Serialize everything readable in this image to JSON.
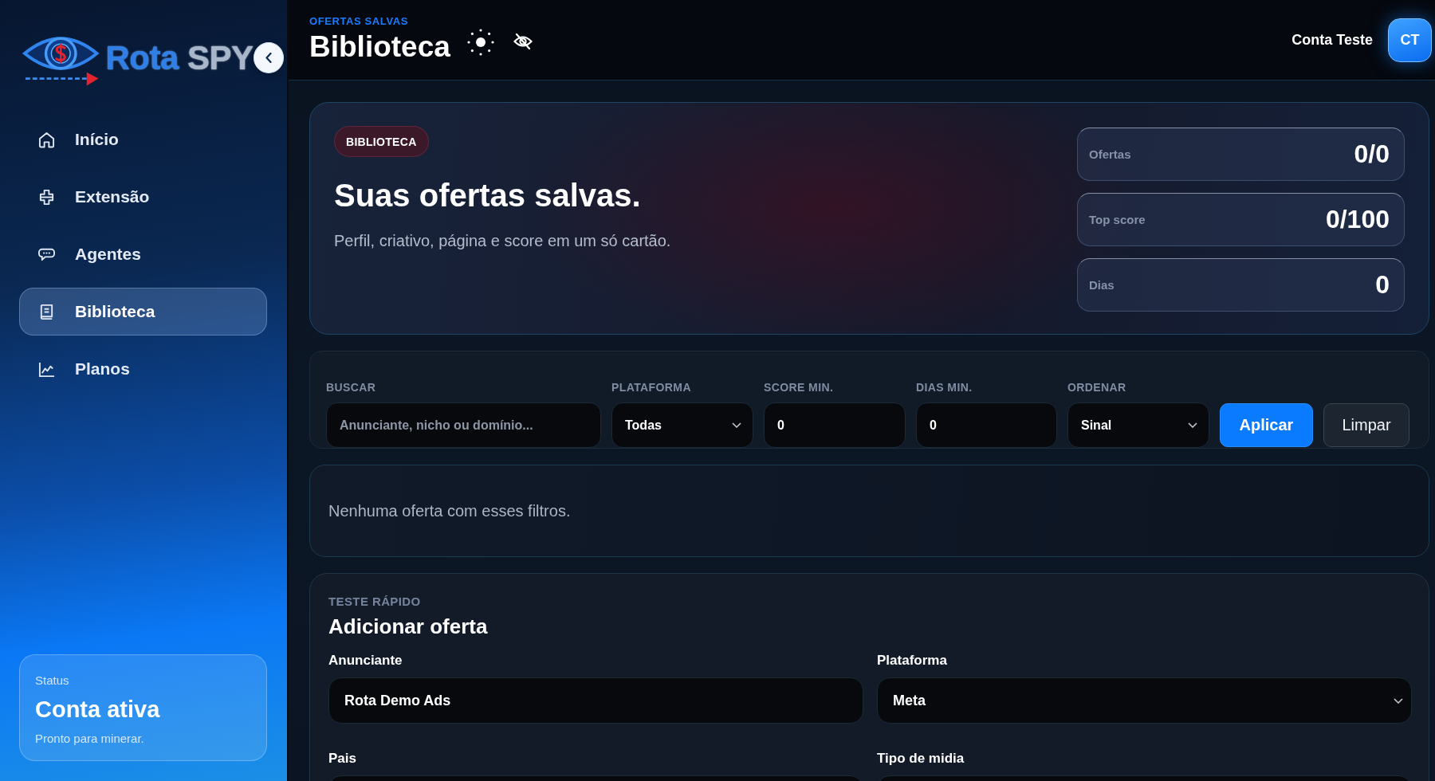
{
  "sidebar": {
    "logo": {
      "words": [
        "Rota",
        "SPY"
      ]
    },
    "items": [
      {
        "label": "Início",
        "selected": false
      },
      {
        "label": "Extensão",
        "selected": false
      },
      {
        "label": "Agentes",
        "selected": false
      },
      {
        "label": "Biblioteca",
        "selected": true
      },
      {
        "label": "Planos",
        "selected": false
      }
    ],
    "status_card": {
      "label": "Status",
      "title": "Conta ativa",
      "description": "Pronto para minerar."
    }
  },
  "header": {
    "eyebrow": "OFERTAS SALVAS",
    "title": "Biblioteca",
    "user_name": "Conta Teste",
    "avatar_initials": "CT"
  },
  "hero": {
    "badge": "BIBLIOTECA",
    "title": "Suas ofertas salvas.",
    "subtitle": "Perfil, criativo, página e score em um só cartão.",
    "stats": [
      {
        "label": "Ofertas",
        "value": "0/0"
      },
      {
        "label": "Top score",
        "value": "0/100"
      },
      {
        "label": "Dias",
        "value": "0"
      }
    ]
  },
  "filters": {
    "fields": [
      {
        "kind": "search",
        "label": "BUSCAR",
        "placeholder": "Anunciante, nicho ou domínio..."
      },
      {
        "kind": "select",
        "label": "PLATAFORMA",
        "value": "Todas"
      },
      {
        "kind": "number",
        "label": "SCORE MIN.",
        "value": "0"
      },
      {
        "kind": "number",
        "label": "DIAS MIN.",
        "value": "0"
      },
      {
        "kind": "select",
        "label": "ORDENAR",
        "value": "Sinal"
      }
    ],
    "buttons": [
      {
        "kind": "primary",
        "label": "Aplicar"
      },
      {
        "kind": "secondary",
        "label": "Limpar"
      }
    ]
  },
  "empty_state": {
    "message": "Nenhuma oferta com esses filtros."
  },
  "add_offer": {
    "eyebrow": "TESTE RÁPIDO",
    "title": "Adicionar oferta",
    "fields": [
      {
        "kind": "text",
        "label": "Anunciante",
        "value": "Rota Demo Ads"
      },
      {
        "kind": "select",
        "label": "Plataforma",
        "value": "Meta"
      },
      {
        "kind": "text",
        "label": "Pais"
      },
      {
        "kind": "text",
        "label": "Tipo de midia"
      }
    ]
  }
}
